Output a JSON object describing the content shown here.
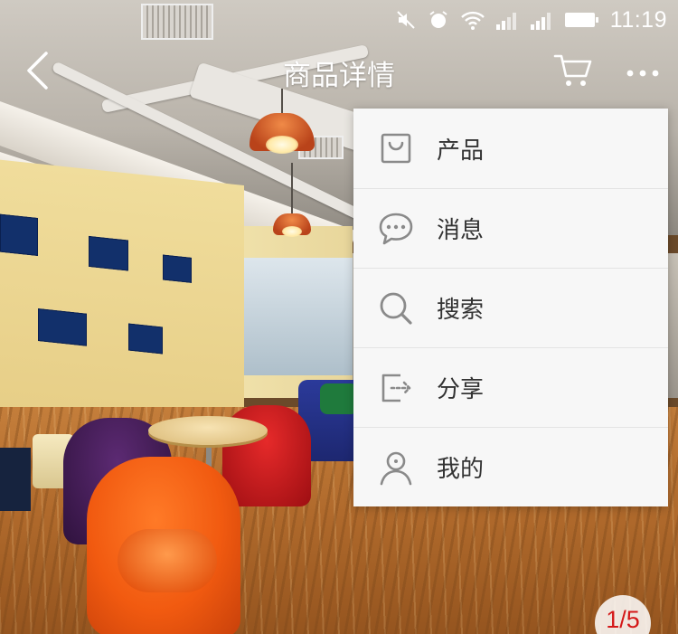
{
  "status_bar": {
    "time": "11:19",
    "icons": [
      "mute-icon",
      "alarm-icon",
      "wifi-icon",
      "signal-1-icon",
      "signal-2-icon",
      "battery-icon"
    ]
  },
  "navbar": {
    "title": "商品详情",
    "back_icon": "chevron-left-icon",
    "cart_icon": "cart-icon",
    "more_icon": "more-horizontal-icon"
  },
  "menu": {
    "items": [
      {
        "label": "产品",
        "icon": "product-bag-icon"
      },
      {
        "label": "消息",
        "icon": "message-bubble-icon"
      },
      {
        "label": "搜索",
        "icon": "search-icon"
      },
      {
        "label": "分享",
        "icon": "share-icon"
      },
      {
        "label": "我的",
        "icon": "profile-icon"
      }
    ]
  },
  "gallery": {
    "pager": "1/5"
  },
  "colors": {
    "menu_bg": "#f7f7f7",
    "menu_text": "#333333",
    "menu_icon": "#8a8a8a",
    "pager_text": "#d41818",
    "nav_text": "#ffffff"
  }
}
